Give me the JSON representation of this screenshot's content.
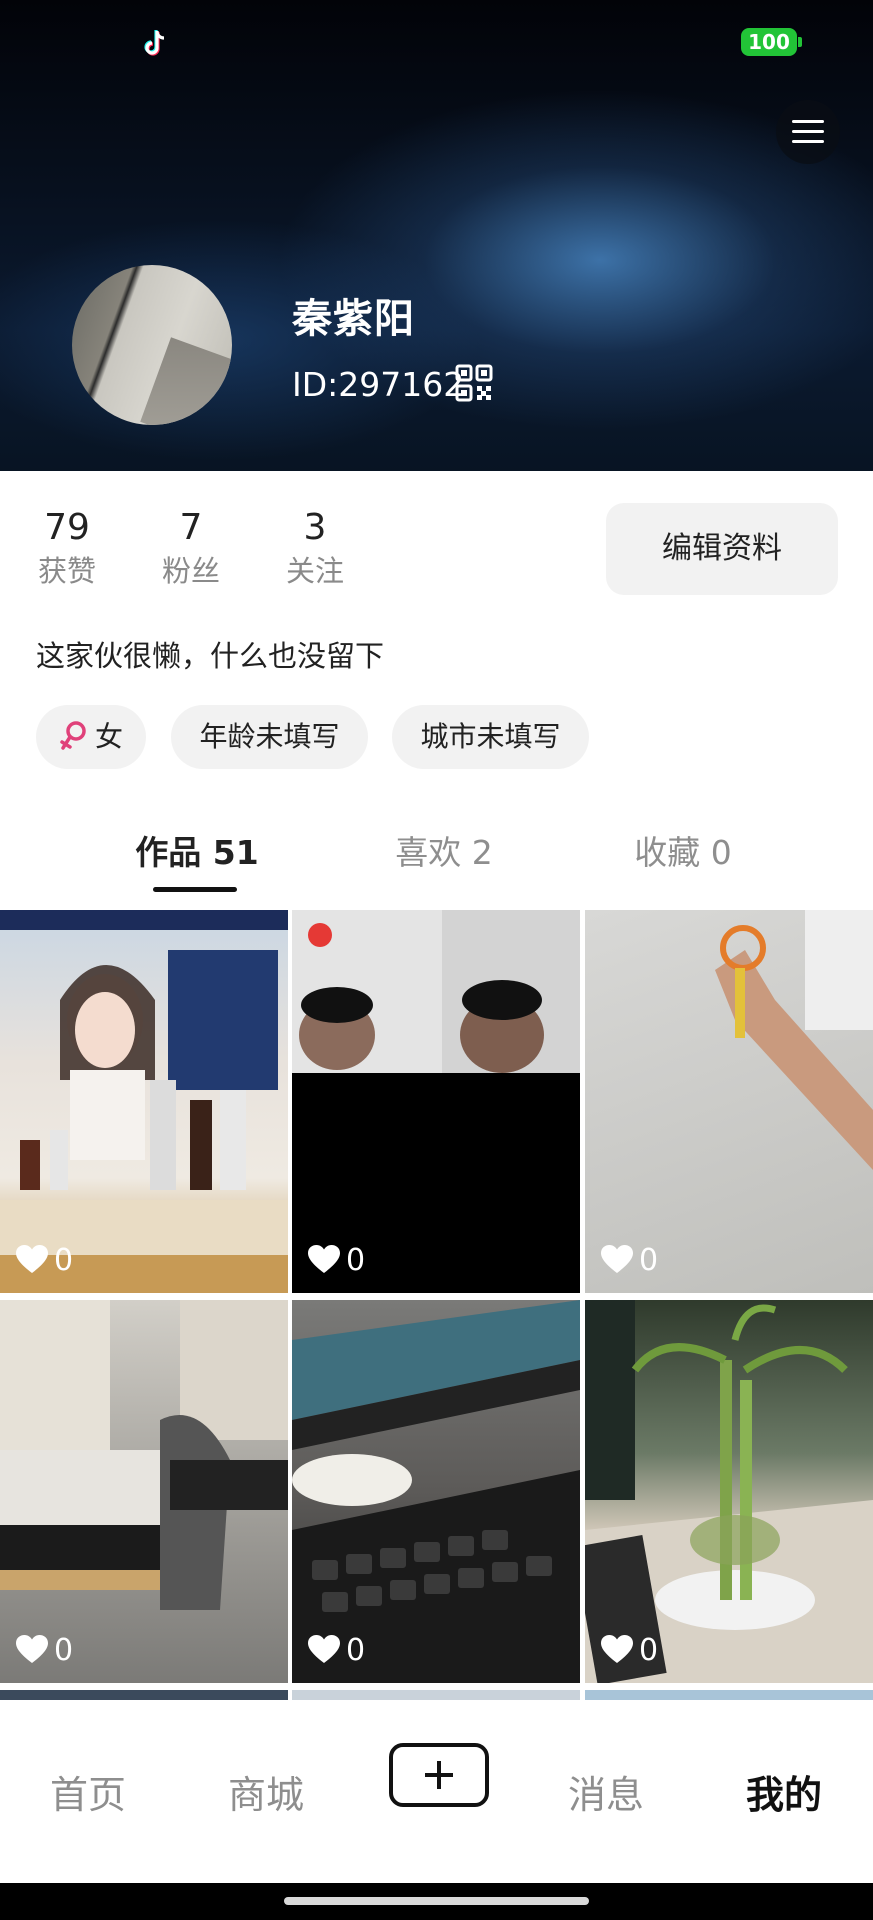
{
  "status_bar": {
    "battery": "100"
  },
  "profile": {
    "name": "秦紫阳",
    "id_text": "ID:297162",
    "stats": [
      {
        "value": "79",
        "label": "获赞"
      },
      {
        "value": "7",
        "label": "粉丝"
      },
      {
        "value": "3",
        "label": "关注"
      }
    ],
    "edit_label": "编辑资料",
    "bio": "这家伙很懒，什么也没留下",
    "tags": {
      "gender": "女",
      "age": "年龄未填写",
      "city": "城市未填写"
    }
  },
  "tabs": [
    {
      "label": "作品 51",
      "active": true
    },
    {
      "label": "喜欢 2",
      "active": false
    },
    {
      "label": "收藏 0",
      "active": false
    }
  ],
  "videos": [
    {
      "likes": "0"
    },
    {
      "likes": "0"
    },
    {
      "likes": "0"
    },
    {
      "likes": "0"
    },
    {
      "likes": "0"
    },
    {
      "likes": "0"
    }
  ],
  "bottom_nav": {
    "home": "首页",
    "mall": "商城",
    "messages": "消息",
    "me": "我的"
  },
  "colors": {
    "battery": "#22c437",
    "female": "#e0417a"
  }
}
